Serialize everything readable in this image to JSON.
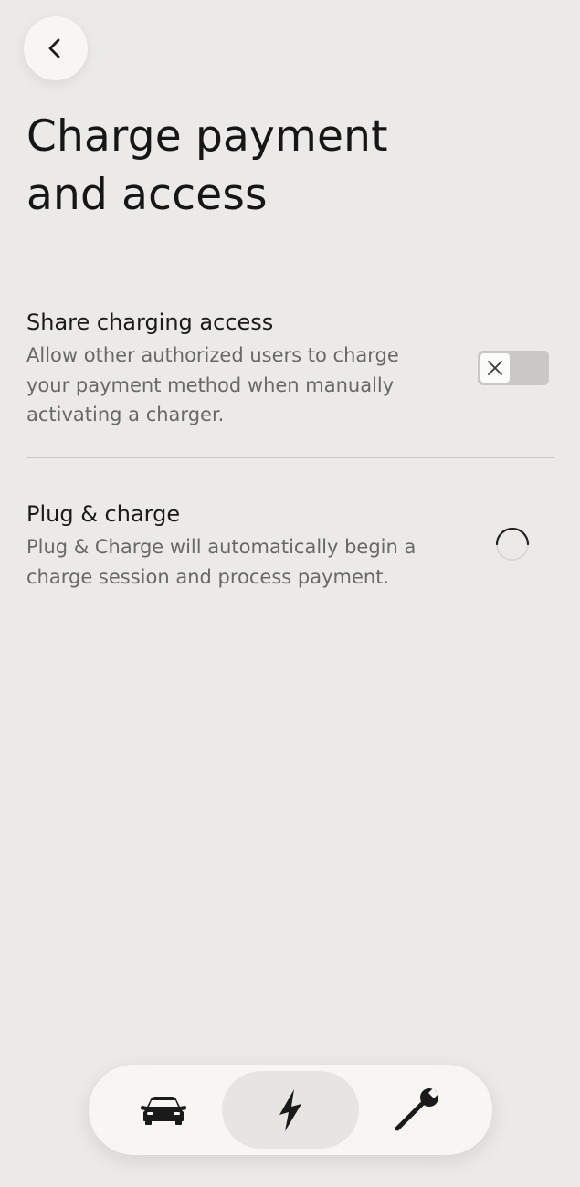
{
  "header": {
    "title": "Charge payment and access"
  },
  "settings": [
    {
      "title": "Share charging access",
      "description": "Allow other authorized users to charge your payment method when manually activating a charger.",
      "control": "toggle",
      "state": "off"
    },
    {
      "title": "Plug & charge",
      "description": "Plug & Charge will automatically begin a charge session and process payment.",
      "control": "loading-spinner",
      "state": "loading"
    }
  ],
  "nav": {
    "items": [
      {
        "icon": "car-icon",
        "selected": false
      },
      {
        "icon": "lightning-bolt-icon",
        "selected": true
      },
      {
        "icon": "wrench-icon",
        "selected": false
      }
    ]
  },
  "colors": {
    "background": "#ebeae8",
    "surface": "#f7f6f3",
    "toggle_track": "#c9c8c6",
    "text_primary": "#1a1a1a",
    "text_secondary": "#686866"
  }
}
